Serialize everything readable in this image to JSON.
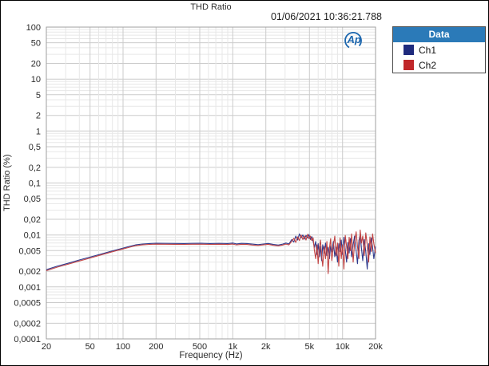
{
  "window": {
    "title": "THD Ratio",
    "timestamp": "01/06/2021 10:36:21.788"
  },
  "logo": {
    "label": "Ap"
  },
  "legend": {
    "header": "Data",
    "items": [
      {
        "label": "Ch1",
        "color": "#1f2b7d"
      },
      {
        "label": "Ch2",
        "color": "#c0272a"
      }
    ]
  },
  "chart_data": {
    "type": "line",
    "title": "THD Ratio",
    "xlabel": "Frequency (Hz)",
    "ylabel": "THD Ratio (%)",
    "x_scale": "log",
    "y_scale": "log",
    "xlim": [
      20,
      20000
    ],
    "ylim": [
      0.0001,
      100
    ],
    "grid": true,
    "legend_position": "outside-top-right",
    "x_ticks": [
      {
        "value": 20,
        "label": "20"
      },
      {
        "value": 50,
        "label": "50"
      },
      {
        "value": 100,
        "label": "100"
      },
      {
        "value": 200,
        "label": "200"
      },
      {
        "value": 500,
        "label": "500"
      },
      {
        "value": 1000,
        "label": "1k"
      },
      {
        "value": 2000,
        "label": "2k"
      },
      {
        "value": 5000,
        "label": "5k"
      },
      {
        "value": 10000,
        "label": "10k"
      },
      {
        "value": 20000,
        "label": "20k"
      }
    ],
    "y_ticks": [
      {
        "value": 100,
        "label": "100"
      },
      {
        "value": 50,
        "label": "50"
      },
      {
        "value": 20,
        "label": "20"
      },
      {
        "value": 10,
        "label": "10"
      },
      {
        "value": 5,
        "label": "5"
      },
      {
        "value": 2,
        "label": "2"
      },
      {
        "value": 1,
        "label": "1"
      },
      {
        "value": 0.5,
        "label": "0,5"
      },
      {
        "value": 0.2,
        "label": "0,2"
      },
      {
        "value": 0.1,
        "label": "0,1"
      },
      {
        "value": 0.05,
        "label": "0,05"
      },
      {
        "value": 0.02,
        "label": "0,02"
      },
      {
        "value": 0.01,
        "label": "0,01"
      },
      {
        "value": 0.005,
        "label": "0,005"
      },
      {
        "value": 0.002,
        "label": "0,002"
      },
      {
        "value": 0.001,
        "label": "0,001"
      },
      {
        "value": 0.0005,
        "label": "0,0005"
      },
      {
        "value": 0.0002,
        "label": "0,0002"
      },
      {
        "value": 0.0001,
        "label": "0,0001"
      }
    ],
    "series": [
      {
        "name": "Ch1",
        "color": "#2f3b8e",
        "points": [
          [
            20,
            0.00215
          ],
          [
            25,
            0.0025
          ],
          [
            31.5,
            0.00285
          ],
          [
            40,
            0.0033
          ],
          [
            50,
            0.00375
          ],
          [
            63,
            0.0043
          ],
          [
            80,
            0.00495
          ],
          [
            100,
            0.0056
          ],
          [
            115,
            0.00605
          ],
          [
            130,
            0.00645
          ],
          [
            150,
            0.0067
          ],
          [
            175,
            0.00685
          ],
          [
            200,
            0.00692
          ],
          [
            240,
            0.0069
          ],
          [
            300,
            0.00688
          ],
          [
            360,
            0.00685
          ],
          [
            430,
            0.0069
          ],
          [
            520,
            0.00692
          ],
          [
            620,
            0.00685
          ],
          [
            750,
            0.0069
          ],
          [
            900,
            0.00685
          ],
          [
            1000,
            0.007
          ],
          [
            1080,
            0.00672
          ],
          [
            1200,
            0.0069
          ],
          [
            1350,
            0.00685
          ],
          [
            1500,
            0.00668
          ],
          [
            1700,
            0.00652
          ],
          [
            1900,
            0.0067
          ],
          [
            2100,
            0.00688
          ],
          [
            2350,
            0.00655
          ],
          [
            2600,
            0.0064
          ],
          [
            2850,
            0.00668
          ],
          [
            3050,
            0.007
          ],
          [
            3250,
            0.00672
          ],
          [
            3450,
            0.0082
          ],
          [
            3600,
            0.0073
          ],
          [
            3750,
            0.0095
          ],
          [
            3900,
            0.008
          ],
          [
            4050,
            0.0105
          ],
          [
            4200,
            0.0088
          ],
          [
            4350,
            0.01
          ],
          [
            4500,
            0.0083
          ],
          [
            4650,
            0.0098
          ],
          [
            4800,
            0.0087
          ],
          [
            4950,
            0.0102
          ],
          [
            5100,
            0.0082
          ],
          [
            5250,
            0.0093
          ],
          [
            5400,
            0.0075
          ],
          [
            5550,
            0.0058
          ],
          [
            5700,
            0.0075
          ],
          [
            5850,
            0.0042
          ],
          [
            6000,
            0.0068
          ],
          [
            6150,
            0.0038
          ],
          [
            6300,
            0.006
          ],
          [
            6450,
            0.0032
          ],
          [
            6600,
            0.0065
          ],
          [
            6800,
            0.0045
          ],
          [
            7000,
            0.007
          ],
          [
            7200,
            0.004
          ],
          [
            7400,
            0.0058
          ],
          [
            7600,
            0.0035
          ],
          [
            7800,
            0.0062
          ],
          [
            8000,
            0.0047
          ],
          [
            8250,
            0.0075
          ],
          [
            8500,
            0.0038
          ],
          [
            8750,
            0.0058
          ],
          [
            9000,
            0.003
          ],
          [
            9250,
            0.0068
          ],
          [
            9500,
            0.0048
          ],
          [
            9750,
            0.008
          ],
          [
            10000,
            0.0042
          ],
          [
            10300,
            0.009
          ],
          [
            10600,
            0.0052
          ],
          [
            10900,
            0.003
          ],
          [
            11200,
            0.0072
          ],
          [
            11500,
            0.0045
          ],
          [
            11800,
            0.0085
          ],
          [
            12100,
            0.0038
          ],
          [
            12500,
            0.0065
          ],
          [
            12900,
            0.0095
          ],
          [
            13300,
            0.005
          ],
          [
            13700,
            0.0028
          ],
          [
            14100,
            0.0078
          ],
          [
            14500,
            0.0102
          ],
          [
            14900,
            0.0055
          ],
          [
            15300,
            0.0032
          ],
          [
            15800,
            0.0082
          ],
          [
            16300,
            0.0048
          ],
          [
            16800,
            0.0022
          ],
          [
            17300,
            0.0068
          ],
          [
            17800,
            0.0042
          ],
          [
            18300,
            0.0088
          ],
          [
            18800,
            0.0058
          ],
          [
            19300,
            0.0035
          ],
          [
            20000,
            0.006
          ]
        ]
      },
      {
        "name": "Ch2",
        "color": "#c14343",
        "points": [
          [
            20,
            0.00205
          ],
          [
            25,
            0.0024
          ],
          [
            31.5,
            0.00273
          ],
          [
            40,
            0.00316
          ],
          [
            50,
            0.0036
          ],
          [
            63,
            0.00413
          ],
          [
            80,
            0.00475
          ],
          [
            100,
            0.00538
          ],
          [
            115,
            0.00582
          ],
          [
            130,
            0.0062
          ],
          [
            150,
            0.00645
          ],
          [
            175,
            0.00658
          ],
          [
            200,
            0.00665
          ],
          [
            240,
            0.00662
          ],
          [
            300,
            0.0066
          ],
          [
            360,
            0.00658
          ],
          [
            430,
            0.00662
          ],
          [
            520,
            0.00664
          ],
          [
            620,
            0.00658
          ],
          [
            750,
            0.00662
          ],
          [
            900,
            0.00656
          ],
          [
            1000,
            0.00668
          ],
          [
            1080,
            0.00645
          ],
          [
            1200,
            0.0066
          ],
          [
            1350,
            0.00655
          ],
          [
            1500,
            0.0064
          ],
          [
            1700,
            0.00628
          ],
          [
            1900,
            0.00645
          ],
          [
            2100,
            0.0066
          ],
          [
            2350,
            0.0063
          ],
          [
            2600,
            0.00618
          ],
          [
            2850,
            0.0064
          ],
          [
            3050,
            0.00668
          ],
          [
            3250,
            0.00645
          ],
          [
            3450,
            0.0076
          ],
          [
            3600,
            0.0086
          ],
          [
            3750,
            0.0072
          ],
          [
            3900,
            0.0092
          ],
          [
            4050,
            0.0078
          ],
          [
            4200,
            0.01
          ],
          [
            4350,
            0.0082
          ],
          [
            4500,
            0.0096
          ],
          [
            4650,
            0.008
          ],
          [
            4800,
            0.0103
          ],
          [
            4950,
            0.0085
          ],
          [
            5100,
            0.0095
          ],
          [
            5250,
            0.0078
          ],
          [
            5400,
            0.0088
          ],
          [
            5550,
            0.005
          ],
          [
            5700,
            0.0035
          ],
          [
            5850,
            0.0065
          ],
          [
            6000,
            0.0028
          ],
          [
            6150,
            0.0058
          ],
          [
            6300,
            0.008
          ],
          [
            6450,
            0.0042
          ],
          [
            6600,
            0.0025
          ],
          [
            6800,
            0.006
          ],
          [
            7000,
            0.0035
          ],
          [
            7200,
            0.0075
          ],
          [
            7400,
            0.0018
          ],
          [
            7600,
            0.0055
          ],
          [
            7800,
            0.0085
          ],
          [
            8000,
            0.0032
          ],
          [
            8250,
            0.006
          ],
          [
            8500,
            0.0095
          ],
          [
            8750,
            0.004
          ],
          [
            9000,
            0.007
          ],
          [
            9250,
            0.0025
          ],
          [
            9500,
            0.0088
          ],
          [
            9750,
            0.0035
          ],
          [
            10000,
            0.0065
          ],
          [
            10300,
            0.0022
          ],
          [
            10600,
            0.0098
          ],
          [
            10900,
            0.006
          ],
          [
            11200,
            0.0035
          ],
          [
            11500,
            0.009
          ],
          [
            11800,
            0.005
          ],
          [
            12100,
            0.0105
          ],
          [
            12500,
            0.003
          ],
          [
            12900,
            0.0072
          ],
          [
            13300,
            0.0115
          ],
          [
            13700,
            0.006
          ],
          [
            14100,
            0.0035
          ],
          [
            14500,
            0.0125
          ],
          [
            14900,
            0.007
          ],
          [
            15300,
            0.0095
          ],
          [
            15800,
            0.004
          ],
          [
            16300,
            0.011
          ],
          [
            16800,
            0.0065
          ],
          [
            17300,
            0.003
          ],
          [
            17800,
            0.0092
          ],
          [
            18300,
            0.0048
          ],
          [
            18800,
            0.0105
          ],
          [
            19300,
            0.0068
          ],
          [
            20000,
            0.0045
          ]
        ]
      }
    ]
  }
}
